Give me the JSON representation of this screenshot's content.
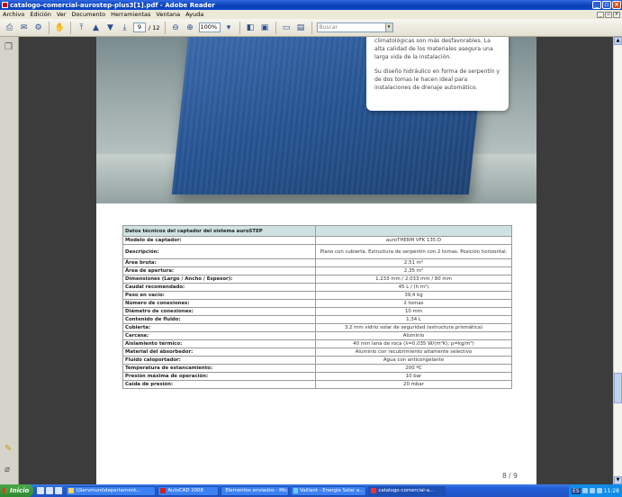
{
  "window": {
    "title": "catalogo-comercial-aurostep-plus3[1].pdf - Adobe Reader"
  },
  "menu": [
    "Archivo",
    "Edición",
    "Ver",
    "Documento",
    "Herramientas",
    "Ventana",
    "Ayuda"
  ],
  "toolbar": {
    "current_page": "9",
    "total_pages": "/ 12",
    "zoom": "100%",
    "search_placeholder": "Buscar"
  },
  "document": {
    "intro_text_1": "climatológicas son más desfavorables. La alta calidad de los materiales asegura una larga vida de la instalación.",
    "intro_text_2": "Su diseño hidráulico en forma de serpentín y de dos tomas le hacen ideal para instalaciones de drenaje automático.",
    "table_header": "Datos técnicos del captador del sistema auroSTEP",
    "rows": [
      {
        "label": "Modelo de captador:",
        "value": "auroTHERM VFK 135 D"
      },
      {
        "label": "Descripción:",
        "value": "Plano con cubierta. Estructura de serpentín con 2 tomas. Posición horizontal."
      },
      {
        "label": "Área bruta:",
        "value": "2,51 m²"
      },
      {
        "label": "Área de apertura:",
        "value": "2,35 m²"
      },
      {
        "label": "Dimensiones (Largo / Ancho / Espesor):",
        "value": "1.233 mm / 2.033 mm / 80 mm"
      },
      {
        "label": "Caudal recomendado:",
        "value": "45 L / (h m²)"
      },
      {
        "label": "Peso en vacío:",
        "value": "39,4 kg"
      },
      {
        "label": "Número de conexiones:",
        "value": "2 tomas"
      },
      {
        "label": "Diámetro de conexiones:",
        "value": "10 mm"
      },
      {
        "label": "Contenido de fluido:",
        "value": "1,34 L"
      },
      {
        "label": "Cubierta:",
        "value": "3,2 mm vidrio solar de seguridad (estructura prismática)"
      },
      {
        "label": "Carcasa:",
        "value": "Aluminio"
      },
      {
        "label": "Aislamiento térmico:",
        "value": "40 mm lana de roca (λ=0,035 W/(m²K); ρ=kg/m³)"
      },
      {
        "label": "Material del absorbedor:",
        "value": "Aluminio con recubrimiento altamente selectivo"
      },
      {
        "label": "Fluido caloportador:",
        "value": "Agua con anticongelante"
      },
      {
        "label": "Temperatura de estancamiento:",
        "value": "200 ºC"
      },
      {
        "label": "Presión máxima de operación:",
        "value": "10 bar"
      },
      {
        "label": "Caída de presión:",
        "value": "20 mbar"
      }
    ],
    "page_number": "8 / 9"
  },
  "taskbar": {
    "start": "Inicio",
    "tasks": [
      "\\\\Servmuro\\departament...",
      "AutoCAD 2008",
      "Elementos enviados - Mic...",
      "Vaillant - Energía Solar a...",
      "catalogo-comercial-a..."
    ],
    "lang": "ES",
    "clock": "11:28"
  }
}
